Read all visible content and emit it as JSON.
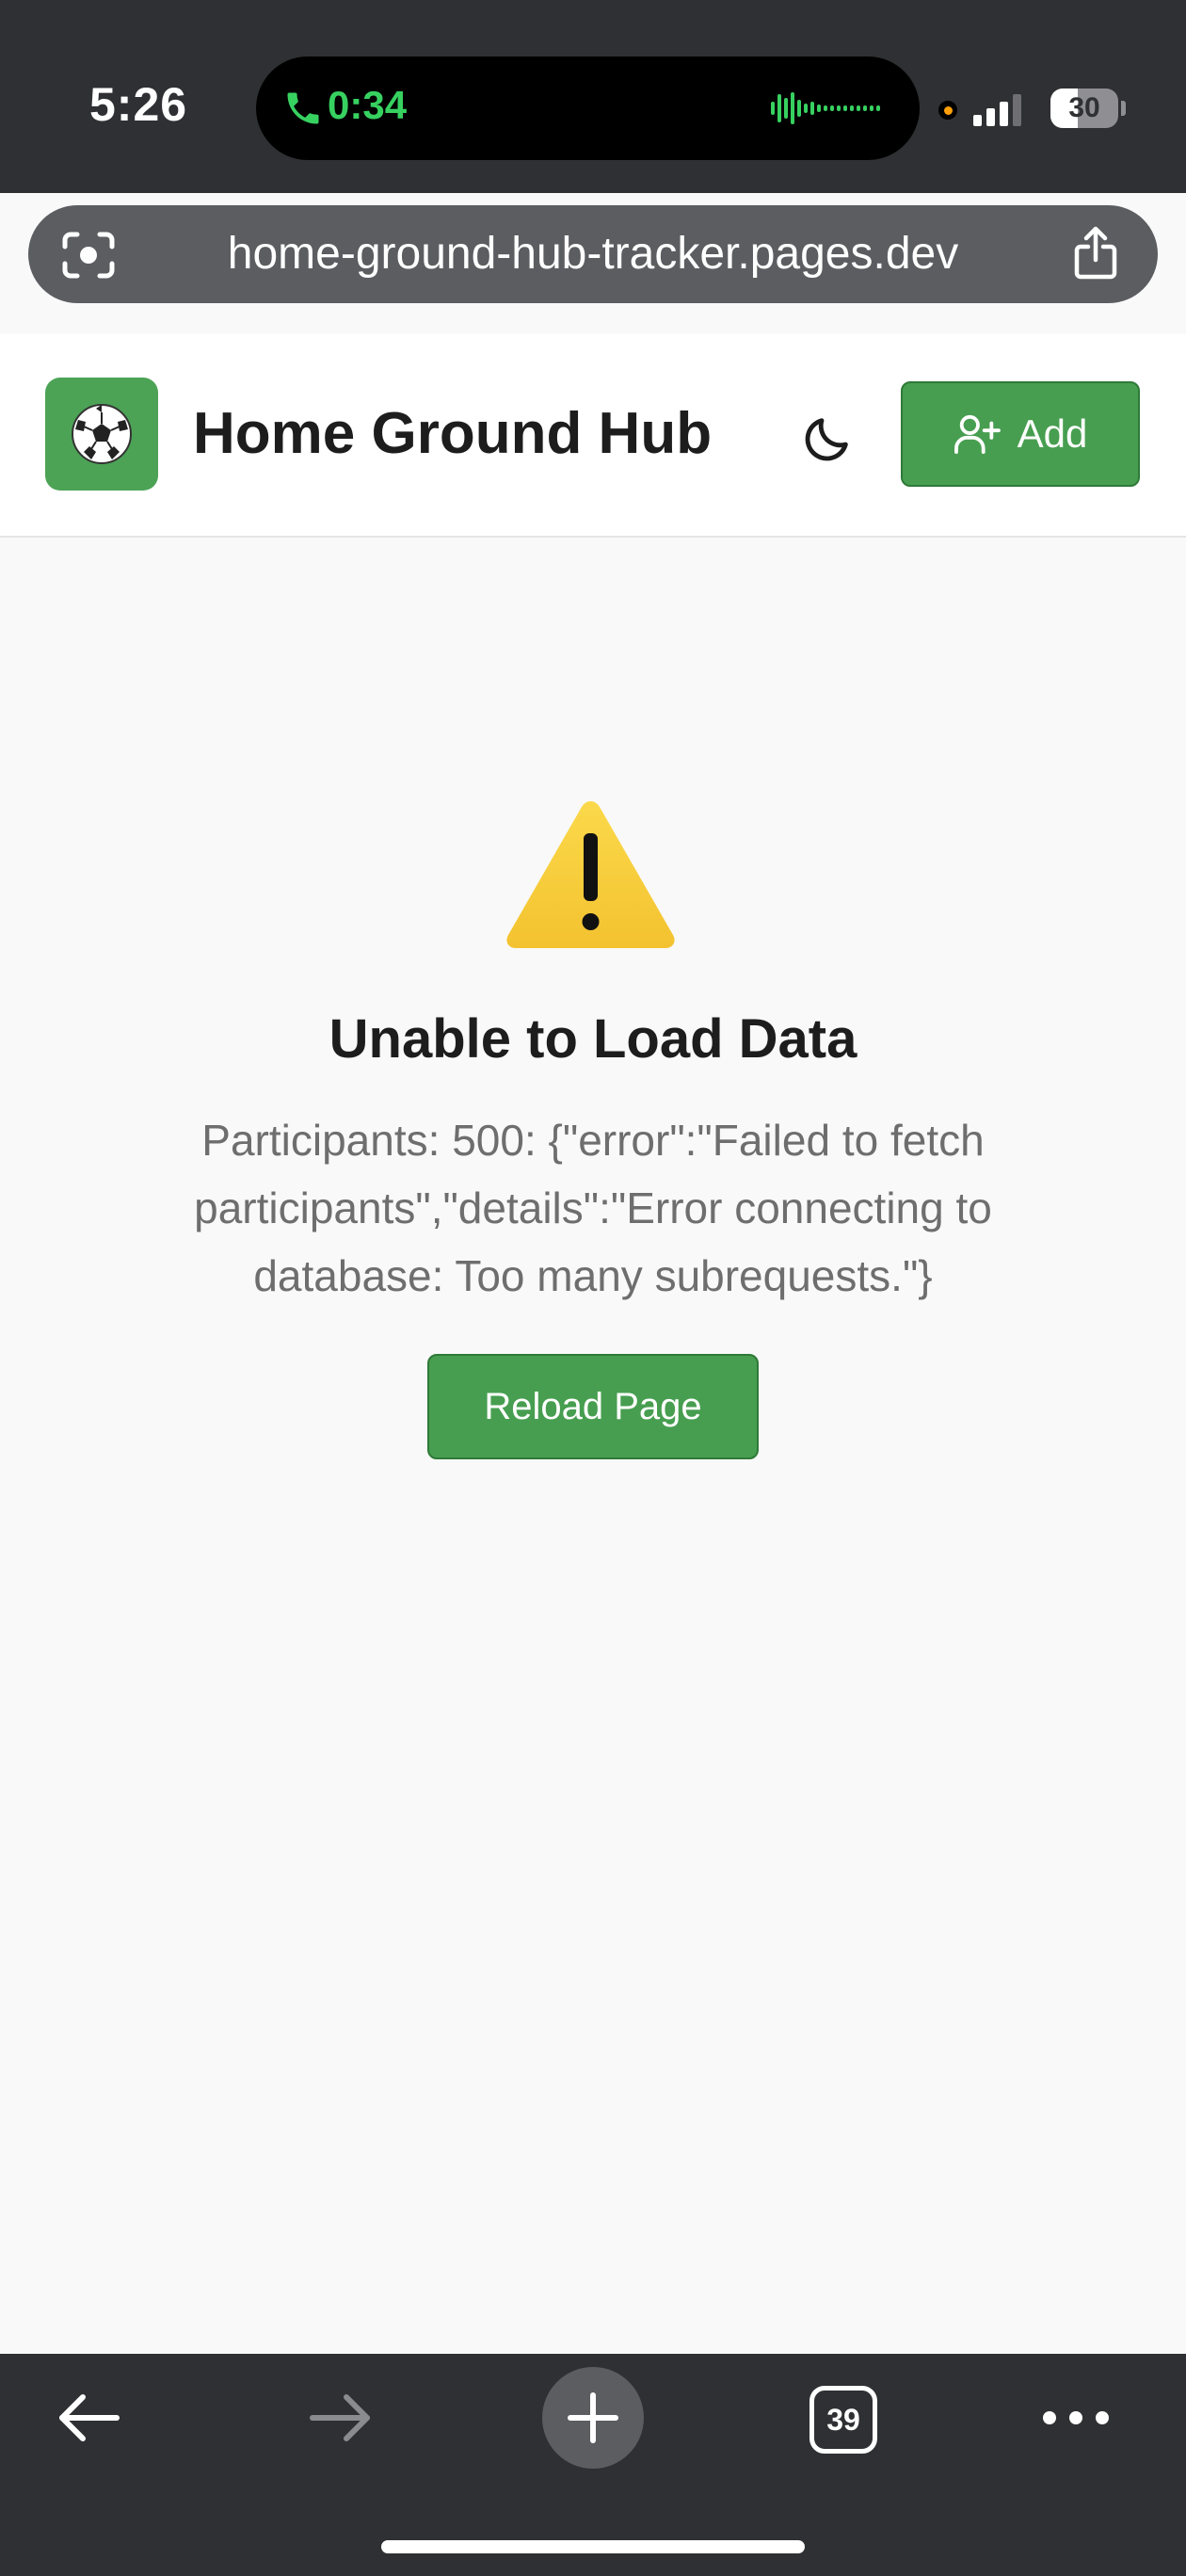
{
  "status_bar": {
    "time": "5:26",
    "call_timer": "0:34",
    "battery_level": "30",
    "colors": {
      "call": "#37d160",
      "recording_dot": "#ff9f0a"
    }
  },
  "browser": {
    "url": "home-ground-hub-tracker.pages.dev",
    "tab_count": "39",
    "icons": [
      "lens-icon",
      "share-icon",
      "back-arrow-icon",
      "forward-arrow-icon",
      "plus-icon",
      "ellipsis-icon"
    ]
  },
  "header": {
    "logo_icon": "⚽",
    "title": "Home Ground Hub",
    "add_label": "Add",
    "theme_icon": "moon-icon"
  },
  "error": {
    "icon": "warning-triangle-icon",
    "title": "Unable to Load Data",
    "details": "Participants: 500: {\"error\":\"Failed to fetch participants\",\"details\":\"Error connecting to database: Too many subrequests.\"}",
    "reload_label": "Reload Page"
  },
  "colors": {
    "brand_green": "#479e50",
    "background": "#f9f9f9",
    "chrome": "#2f3033"
  }
}
